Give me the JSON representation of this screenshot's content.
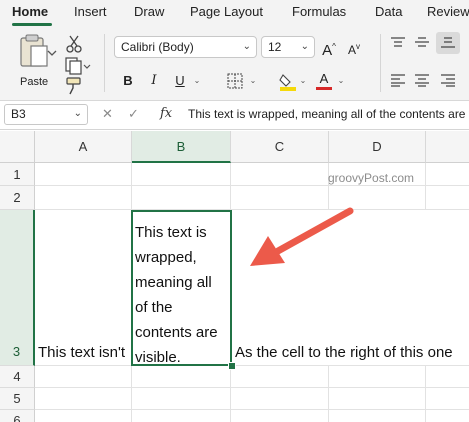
{
  "ribbon_tabs": [
    "Home",
    "Insert",
    "Draw",
    "Page Layout",
    "Formulas",
    "Data",
    "Review"
  ],
  "ribbon": {
    "paste_label": "Paste",
    "font_name": "Calibri (Body)",
    "font_size": "12",
    "bold": "B",
    "italic": "I",
    "underline": "U",
    "increase_font": "A",
    "decrease_font": "A",
    "font_color_glyph": "A",
    "highlight_color": "#f5d90a",
    "font_color": "#d62828"
  },
  "formula_bar": {
    "name_box": "B3",
    "cancel": "✕",
    "confirm": "✓",
    "fx": "fx",
    "content": "This text is wrapped, meaning all of the contents are visible."
  },
  "columns": [
    "A",
    "B",
    "C",
    "D"
  ],
  "rows": [
    "1",
    "2",
    "3",
    "4",
    "5",
    "6"
  ],
  "cells": {
    "A3": "This text isn't",
    "B3": "This text is\nwrapped,\nmeaning all\nof the\ncontents are\nvisible.",
    "C3": "As the cell to the right of this one"
  },
  "watermark": "groovyPost.com",
  "accent_color": "#217346",
  "annotation_arrow_color": "#ec5a4a"
}
